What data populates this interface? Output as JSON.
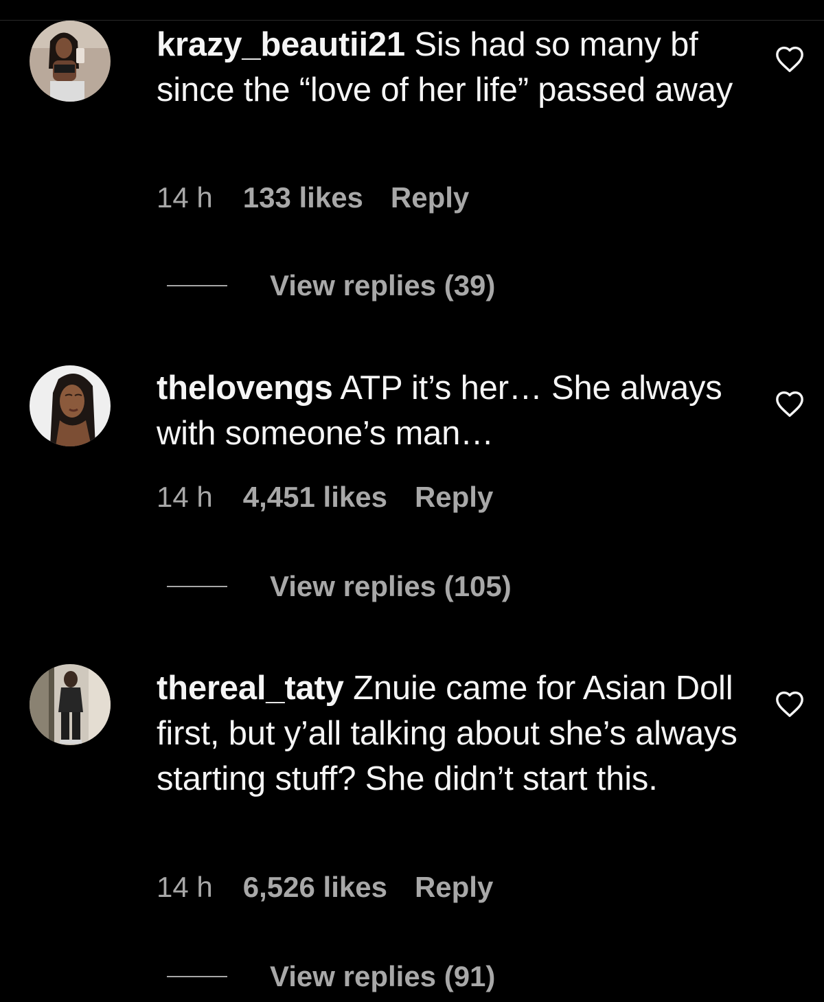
{
  "colors": {
    "background": "#000000",
    "text": "#f5f5f5",
    "secondary_text": "#a8a8a8"
  },
  "comments": [
    {
      "username": "krazy_beautii21",
      "text": "Sis had so many bf since the “love of her life” passed away",
      "time": "14 h",
      "likes": "133 likes",
      "reply_label": "Reply",
      "view_replies": "View replies (39)",
      "like_icon": "heart-outline-icon"
    },
    {
      "username": "thelovengs",
      "text": "ATP it’s her… She always with someone’s man…",
      "time": "14 h",
      "likes": "4,451 likes",
      "reply_label": "Reply",
      "view_replies": "View replies (105)",
      "like_icon": "heart-outline-icon"
    },
    {
      "username": "thereal_taty",
      "text": "Znuie came for Asian Doll first, but y’all talking about she’s always starting stuff? She didn’t start this.",
      "time": "14 h",
      "likes": "6,526 likes",
      "reply_label": "Reply",
      "view_replies": "View replies (91)",
      "like_icon": "heart-outline-icon"
    }
  ]
}
